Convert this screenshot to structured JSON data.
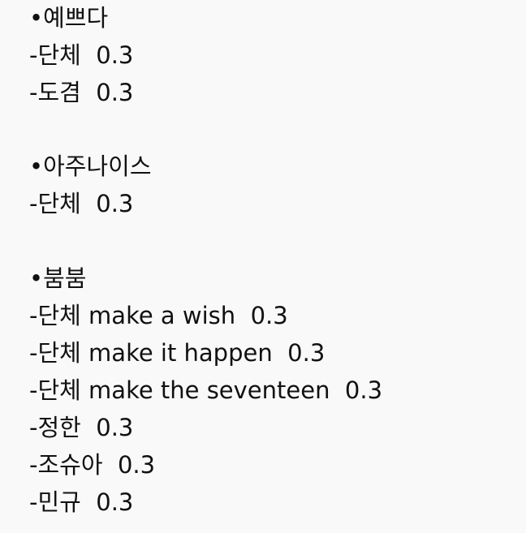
{
  "sections": [
    {
      "heading": "•예쁘다",
      "items": [
        "-단체  0.3",
        "-도겸  0.3"
      ]
    },
    {
      "heading": "•아주나이스",
      "items": [
        "-단체  0.3"
      ]
    },
    {
      "heading": "•붐붐",
      "items": [
        "-단체 make a wish  0.3",
        "-단체 make it happen  0.3",
        "-단체 make the seventeen  0.3",
        "-정한  0.3",
        "-조슈아  0.3",
        "-민규  0.3"
      ]
    }
  ]
}
